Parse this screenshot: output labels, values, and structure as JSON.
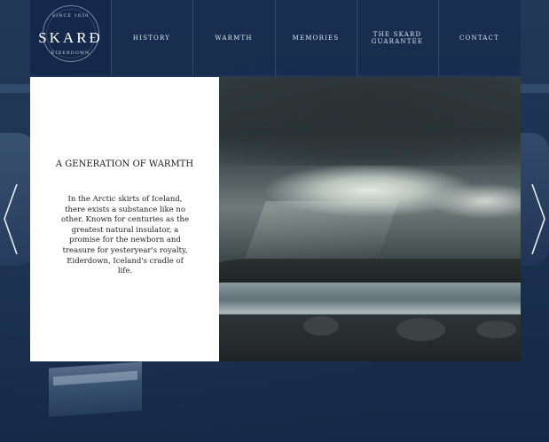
{
  "logo": {
    "top_text": "SINCE 1830",
    "title": "SKARÐ",
    "bottom_text": "EIDERDOWN"
  },
  "nav": {
    "items": [
      {
        "label": "HISTORY"
      },
      {
        "label": "WARMTH"
      },
      {
        "label": "MEMORIES"
      },
      {
        "label": "THE SKARD GUARANTEE"
      },
      {
        "label": "CONTACT"
      }
    ]
  },
  "card": {
    "title": "A GENERATION OF WARMTH",
    "text": "In the Arctic skirts of Iceland, there exists a substance like no other. Known for centuries as the greatest natural insulator, a promise for the newborn and treasure for yesteryear's royalty, Eiderdown, Iceland's cradle of life."
  },
  "slider": {
    "prev_icon": "chevron-left-icon",
    "next_icon": "chevron-right-icon"
  },
  "colors": {
    "header_bg": "#162c4e",
    "page_bg": "#1d3554",
    "card_bg": "#ffffff"
  }
}
